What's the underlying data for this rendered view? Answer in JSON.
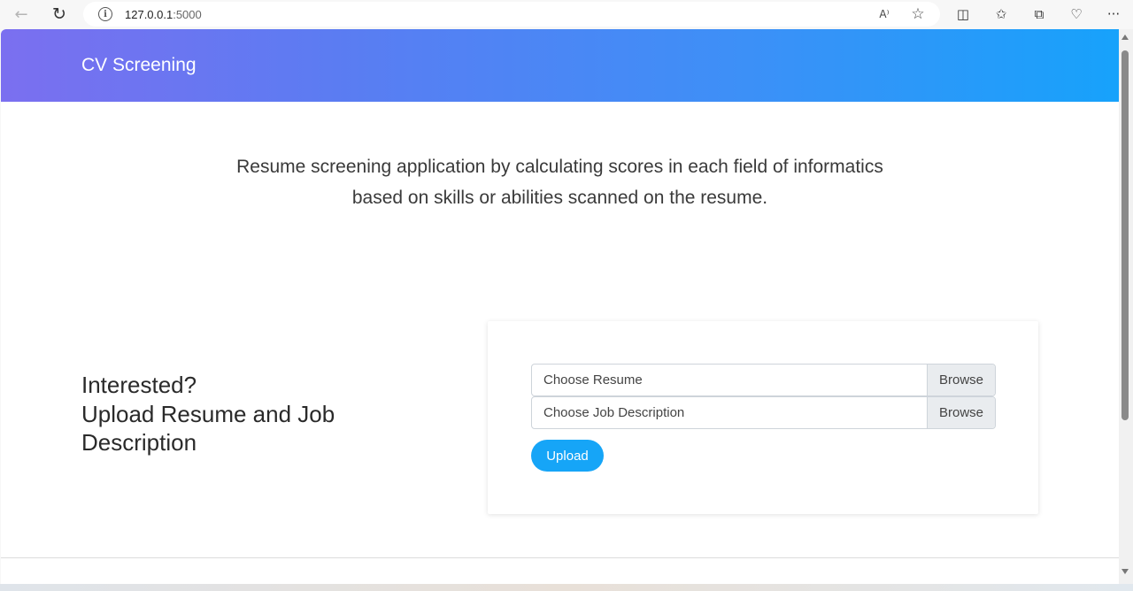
{
  "browser": {
    "url_host": "127.0.0.1",
    "url_port": ":5000",
    "back_glyph": "←",
    "refresh_glyph": "↻",
    "info_glyph": "i",
    "read_aloud_glyph": "A⁾",
    "star_glyph": "☆",
    "split_glyph": "◫",
    "favorites_glyph": "✩",
    "collections_glyph": "⧉",
    "extensions_glyph": "♡",
    "more_glyph": "···"
  },
  "header": {
    "brand": "CV Screening"
  },
  "main": {
    "tagline_line1": "Resume screening application by calculating scores in each field of informatics",
    "tagline_line2": "based on skills or abilities scanned on the resume.",
    "cta_line1": "Interested?",
    "cta_line2": "Upload Resume and Job",
    "cta_line3": "Description"
  },
  "form": {
    "resume_label": "Choose Resume",
    "resume_browse": "Browse",
    "jd_label": "Choose Job Description",
    "jd_browse": "Browse",
    "upload_label": "Upload"
  },
  "colors": {
    "header_gradient_start": "#7b6ff0",
    "header_gradient_end": "#17a2fb",
    "upload_button": "#16a5f7"
  }
}
